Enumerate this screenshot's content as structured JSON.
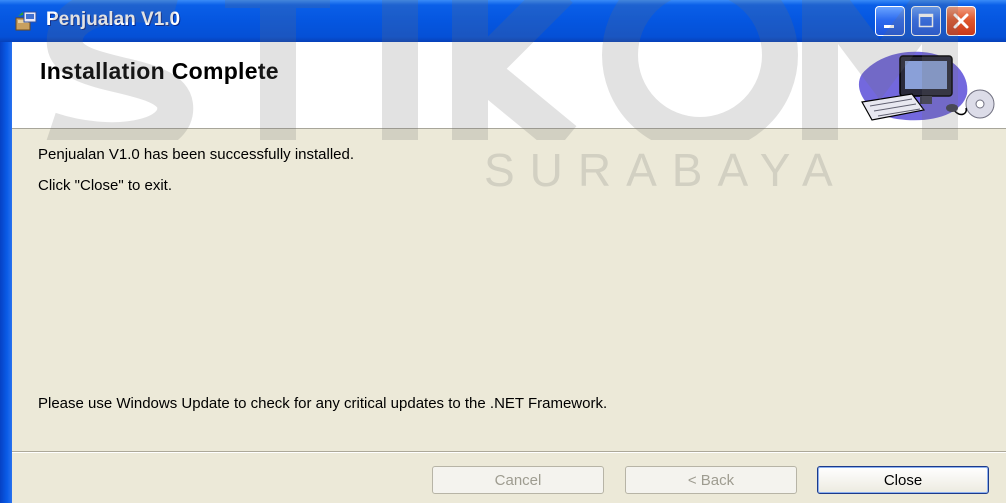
{
  "window": {
    "title": "Penjualan V1.0",
    "colors": {
      "titlebar": "#0556e0",
      "body": "#ece9d8",
      "close": "#e0582d"
    }
  },
  "header": {
    "title": "Installation Complete"
  },
  "content": {
    "line1": "Penjualan V1.0 has been successfully installed.",
    "line2": "Click \"Close\" to exit.",
    "line3": "Please use Windows Update to check for any critical updates to the .NET Framework."
  },
  "watermark": {
    "logo": "stikom",
    "subtitle": "SURABAYA"
  },
  "buttons": {
    "cancel": "Cancel",
    "back": "< Back",
    "close": "Close"
  },
  "icons": {
    "app": "installer-icon",
    "minimize": "minimize-icon",
    "maximize": "maximize-icon",
    "close": "close-icon",
    "banner": "computer-illustration"
  }
}
